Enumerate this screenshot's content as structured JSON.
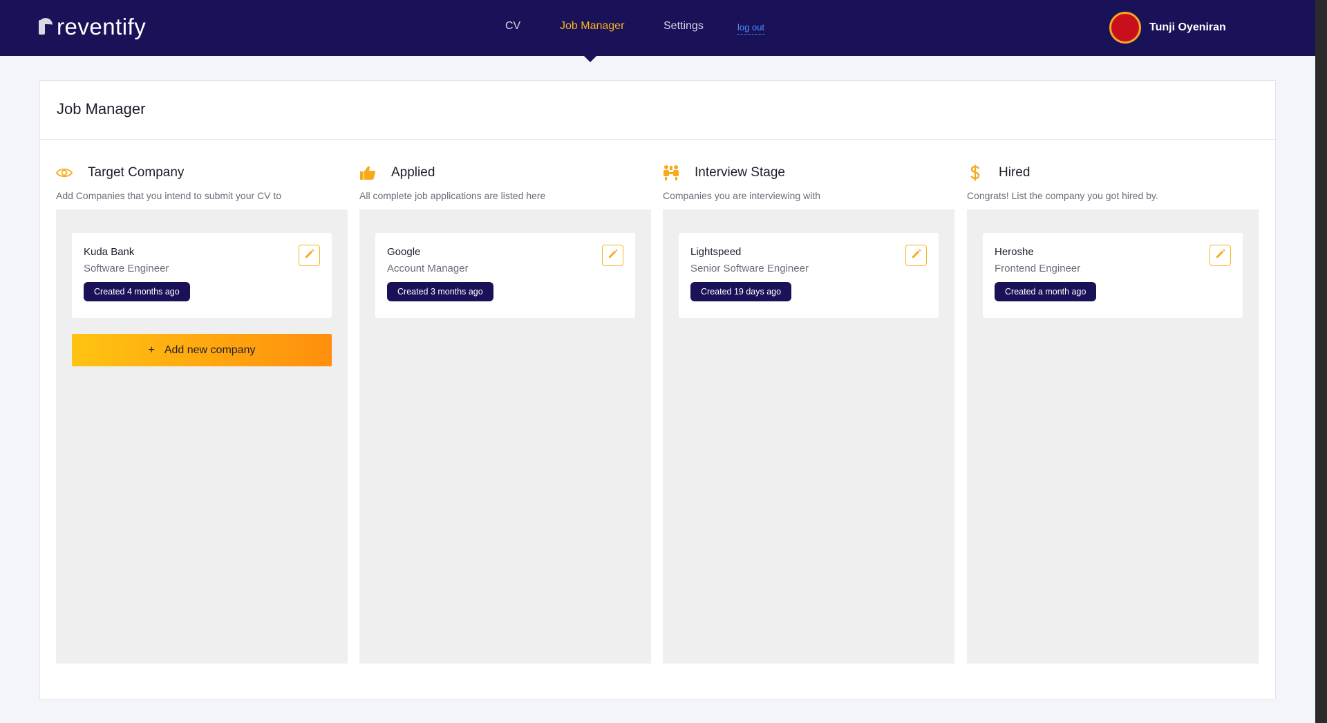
{
  "app": {
    "logo_text": "reventify"
  },
  "nav": {
    "cv": "CV",
    "job_manager": "Job Manager",
    "settings": "Settings",
    "logout": "log out"
  },
  "user": {
    "name": "Tunji Oyeniran"
  },
  "page": {
    "title": "Job Manager"
  },
  "columns": [
    {
      "title": "Target Company",
      "description": "Add Companies that you intend to submit your CV to",
      "icon": "eye-icon",
      "cards": [
        {
          "company": "Kuda Bank",
          "role": "Software Engineer",
          "created": "Created 4 months ago"
        }
      ],
      "add_label": "Add new company"
    },
    {
      "title": "Applied",
      "description": "All complete job applications are listed here",
      "icon": "thumbs-up-icon",
      "cards": [
        {
          "company": "Google",
          "role": "Account Manager",
          "created": "Created 3 months ago"
        }
      ]
    },
    {
      "title": "Interview Stage",
      "description": "Companies you are interviewing with",
      "icon": "meeting-icon",
      "cards": [
        {
          "company": "Lightspeed",
          "role": "Senior Software Engineer",
          "created": "Created 19 days ago"
        }
      ]
    },
    {
      "title": "Hired",
      "description": "Congrats! List the company you got hired by.",
      "icon": "dollar-icon",
      "cards": [
        {
          "company": "Heroshe",
          "role": "Frontend Engineer",
          "created": "Created a month ago"
        }
      ]
    }
  ],
  "colors": {
    "header_bg": "#1a1258",
    "accent": "#f7b51d",
    "badge_bg": "#1a1258",
    "board_bg": "#efefef"
  }
}
